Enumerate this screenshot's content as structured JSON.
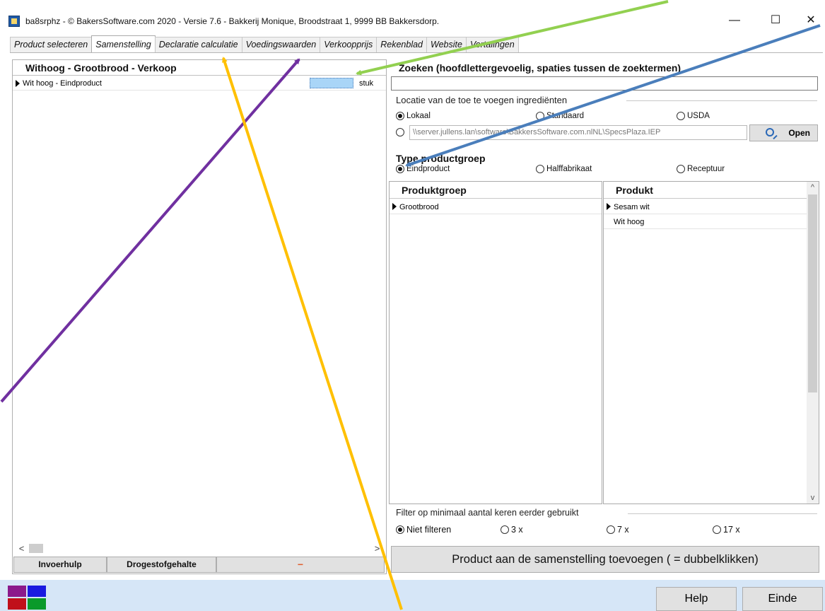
{
  "window": {
    "title": "ba8srphz - © BakersSoftware.com 2020 - Versie 7.6 - Bakkerij Monique, Broodstraat 1, 9999 BB Bakkersdorp.",
    "minimize": "—",
    "maximize": "☐",
    "close": "✕"
  },
  "tabs": [
    {
      "label": "Product selecteren"
    },
    {
      "label": "Samenstelling",
      "active": true
    },
    {
      "label": "Declaratie calculatie"
    },
    {
      "label": "Voedingswaarden"
    },
    {
      "label": "Verkoopprijs"
    },
    {
      "label": "Rekenblad"
    },
    {
      "label": "Website"
    },
    {
      "label": "Vertalingen"
    }
  ],
  "left_panel": {
    "header": "Withoog - Grootbrood - Verkoop",
    "rows": [
      {
        "name": "Wit hoog - Eindproduct",
        "quantity": "",
        "unit": "stuk"
      }
    ],
    "scroll_left": "<",
    "scroll_right": ">",
    "buttons": {
      "invoerhulp": "Invoerhulp",
      "drogestof": "Drogestofgehalte",
      "minus": "−"
    }
  },
  "right_panel": {
    "search_label": "Zoeken (hoofdlettergevoelig, spaties tussen de zoektermen)",
    "search_value": "",
    "location_label": "Locatie van de toe te voegen ingrediënten",
    "location_options": [
      {
        "label": "Lokaal",
        "selected": true
      },
      {
        "label": "Standaard",
        "selected": false
      },
      {
        "label": "USDA",
        "selected": false
      }
    ],
    "path_value": "\\\\server.jullens.lan\\software\\BakkersSoftware.com.nlNL\\SpecsPlaza.IEP",
    "open_button": "Open",
    "type_label": "Type productgroep",
    "type_options": [
      {
        "label": "Eindproduct",
        "selected": true
      },
      {
        "label": "Halffabrikaat",
        "selected": false
      },
      {
        "label": "Receptuur",
        "selected": false
      }
    ],
    "group_header": "Produktgroep",
    "groups": [
      "Grootbrood"
    ],
    "product_header": "Produkt",
    "products": [
      "Sesam wit",
      "Wit hoog"
    ],
    "filter_label": "Filter op minimaal aantal keren eerder gebruikt",
    "filter_options": [
      {
        "label": "Niet filteren",
        "selected": true
      },
      {
        "label": "3 x",
        "selected": false
      },
      {
        "label": "7 x",
        "selected": false
      },
      {
        "label": "17 x",
        "selected": false
      }
    ],
    "add_button": "Product aan de samenstelling toevoegen ( = dubbelklikken)"
  },
  "footer": {
    "help": "Help",
    "einde": "Einde"
  },
  "colors": {
    "accent_highlight": "#a9d5f7",
    "footer_bg": "#d6e6f7",
    "arrow_green": "#92d050",
    "arrow_blue": "#4a7ebb",
    "arrow_purple": "#7030a0",
    "arrow_yellow": "#ffc000",
    "logo_purple": "#8b1a8b",
    "logo_blue": "#1a1ae0",
    "logo_red": "#c0101a",
    "logo_green": "#0a9a2a"
  }
}
